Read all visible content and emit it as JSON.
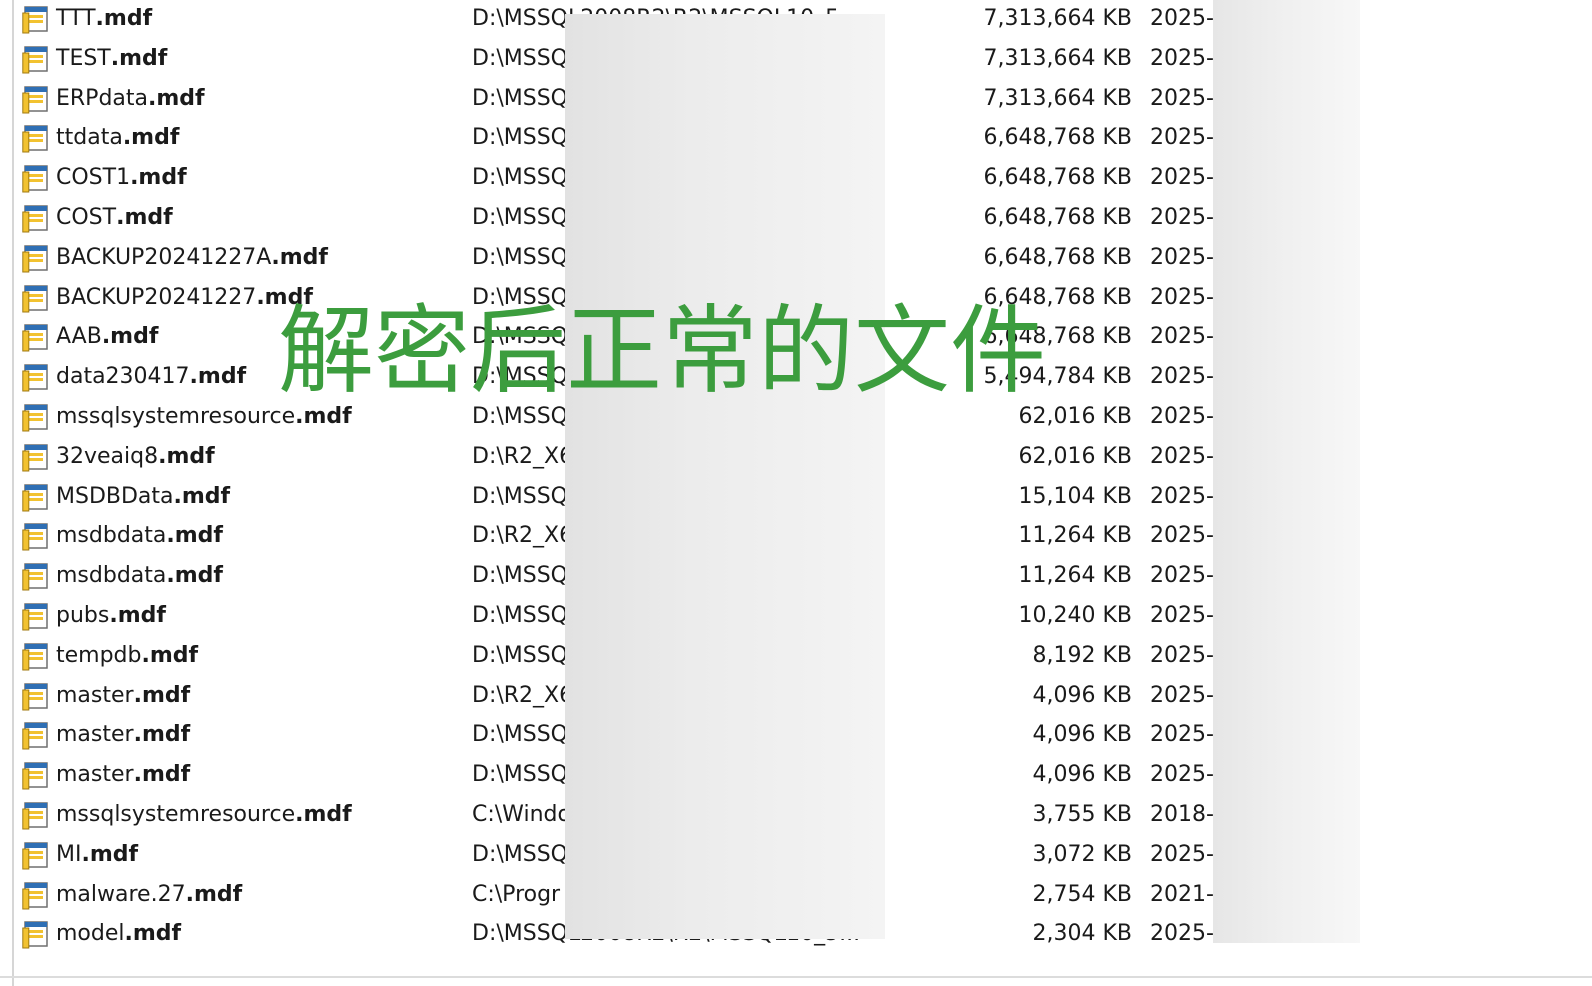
{
  "rows": [
    {
      "base": "TTT",
      "ext": ".mdf",
      "path": "D:\\MSSQL2008R2\\R2\\MSSQL10_5",
      "size": "7,313,664 KB",
      "date": "2025-"
    },
    {
      "base": "TEST",
      "ext": ".mdf",
      "path": "D:\\MSSQ",
      "size": "7,313,664 KB",
      "date": "2025-"
    },
    {
      "base": "ERPdata",
      "ext": ".mdf",
      "path": "D:\\MSSQ",
      "size": "7,313,664 KB",
      "date": "2025-"
    },
    {
      "base": "ttdata",
      "ext": ".mdf",
      "path": "D:\\MSSQ",
      "size": "6,648,768 KB",
      "date": "2025-"
    },
    {
      "base": "COST1",
      "ext": ".mdf",
      "path": "D:\\MSSQ",
      "size": "6,648,768 KB",
      "date": "2025-"
    },
    {
      "base": "COST",
      "ext": ".mdf",
      "path": "D:\\MSSQ",
      "size": "6,648,768 KB",
      "date": "2025-"
    },
    {
      "base": "BACKUP20241227A",
      "ext": ".mdf",
      "path": "D:\\MSSQ",
      "size": "6,648,768 KB",
      "date": "2025-"
    },
    {
      "base": "BACKUP20241227",
      "ext": ".mdf",
      "path": "D:\\MSSQ",
      "size": "6,648,768 KB",
      "date": "2025-"
    },
    {
      "base": "AAB",
      "ext": ".mdf",
      "path": "D:\\MSSQ",
      "size": "6,648,768 KB",
      "date": "2025-"
    },
    {
      "base": "data230417",
      "ext": ".mdf",
      "path": "D:\\MSSQ",
      "size": "5,494,784 KB",
      "date": "2025-"
    },
    {
      "base": "mssqlsystemresource",
      "ext": ".mdf",
      "path": "D:\\MSSQ",
      "size": "62,016 KB",
      "date": "2025-"
    },
    {
      "base": "32veaiq8",
      "ext": ".mdf",
      "path": "D:\\R2_X6",
      "size": "62,016 KB",
      "date": "2025-"
    },
    {
      "base": "MSDBData",
      "ext": ".mdf",
      "path": "D:\\MSSQ",
      "size": "15,104 KB",
      "date": "2025-"
    },
    {
      "base": "msdbdata",
      "ext": ".mdf",
      "path": "D:\\R2_X6",
      "size": "11,264 KB",
      "date": "2025-"
    },
    {
      "base": "msdbdata",
      "ext": ".mdf",
      "path": "D:\\MSSQ",
      "size": "11,264 KB",
      "date": "2025-"
    },
    {
      "base": "pubs",
      "ext": ".mdf",
      "path": "D:\\MSSQ",
      "size": "10,240 KB",
      "date": "2025-"
    },
    {
      "base": "tempdb",
      "ext": ".mdf",
      "path": "D:\\MSSQ",
      "size": "8,192 KB",
      "date": "2025-"
    },
    {
      "base": "master",
      "ext": ".mdf",
      "path": "D:\\R2_X6",
      "size": "4,096 KB",
      "date": "2025-"
    },
    {
      "base": "master",
      "ext": ".mdf",
      "path": "D:\\MSSQ",
      "size": "4,096 KB",
      "date": "2025-"
    },
    {
      "base": "master",
      "ext": ".mdf",
      "path": "D:\\MSSQ",
      "size": "4,096 KB",
      "date": "2025-"
    },
    {
      "base": "mssqlsystemresource",
      "ext": ".mdf",
      "path": "C:\\Windo",
      "size": "3,755 KB",
      "date": "2018-"
    },
    {
      "base": "MI",
      "ext": ".mdf",
      "path": "D:\\MSSQ",
      "size": "3,072 KB",
      "date": "2025-"
    },
    {
      "base": "malware.27",
      "ext": ".mdf",
      "path": "C:\\Progr",
      "size": "2,754 KB",
      "date": "2021-"
    },
    {
      "base": "model",
      "ext": ".mdf",
      "path": "D:\\MSSQL2008R2\\R2\\MSSQL10_5...",
      "size": "2,304 KB",
      "date": "2025-"
    }
  ],
  "overlay_caption": "解密后正常的文件",
  "icons": {
    "file": "database-file-icon"
  },
  "colors": {
    "overlay": "#3c9d3e",
    "icon_yellow": "#f2c230",
    "icon_blue": "#2f6fb4"
  }
}
